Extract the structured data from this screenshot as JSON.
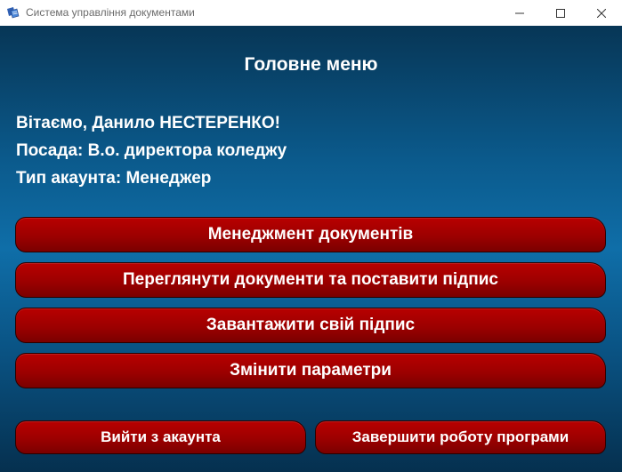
{
  "window": {
    "title": "Система управління документами",
    "icon": "app-document-icon"
  },
  "main": {
    "heading": "Головне меню",
    "greeting": "Вітаємо, Данило НЕСТЕРЕНКО!",
    "position": "Посада: В.о. директора коледжу",
    "account_type": "Тип акаунта: Менеджер"
  },
  "buttons": {
    "document_management": "Менеджмент документів",
    "view_and_sign": "Переглянути документи та поставити підпис",
    "upload_signature": "Завантажити свій підпис",
    "change_settings": "Змінити параметри",
    "logout": "Вийти з акаунта",
    "exit_program": "Завершити роботу програми"
  },
  "colors": {
    "background_top": "#073656",
    "background_mid": "#0f6ea8",
    "button_red": "#9c0000",
    "text": "#ffffff"
  }
}
